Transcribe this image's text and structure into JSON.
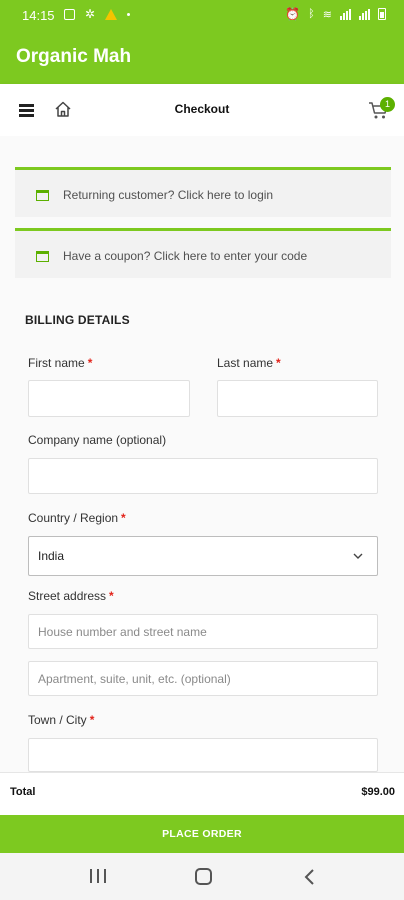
{
  "status_bar": {
    "time": "14:15"
  },
  "app": {
    "title": "Organic Mah"
  },
  "toolbar": {
    "title": "Checkout",
    "cart_count": "1"
  },
  "notices": [
    {
      "text": "Returning customer? Click here to login"
    },
    {
      "text": "Have a coupon? Click here to enter your code"
    }
  ],
  "billing": {
    "heading": "BILLING DETAILS",
    "required_mark": "*",
    "first_name": {
      "label": "First name",
      "value": ""
    },
    "last_name": {
      "label": "Last name",
      "value": ""
    },
    "company": {
      "label": "Company name (optional)",
      "value": ""
    },
    "country": {
      "label": "Country / Region",
      "value": "India"
    },
    "street": {
      "label": "Street address",
      "placeholder_1": "House number and street name",
      "placeholder_2": "Apartment, suite, unit, etc. (optional)"
    },
    "city": {
      "label": "Town / City",
      "value": ""
    }
  },
  "order": {
    "total_label": "Total",
    "total_value": "$99.00",
    "place_order_label": "PLACE ORDER"
  },
  "colors": {
    "brand_green": "#7dc920",
    "required_red": "#e2231a"
  }
}
